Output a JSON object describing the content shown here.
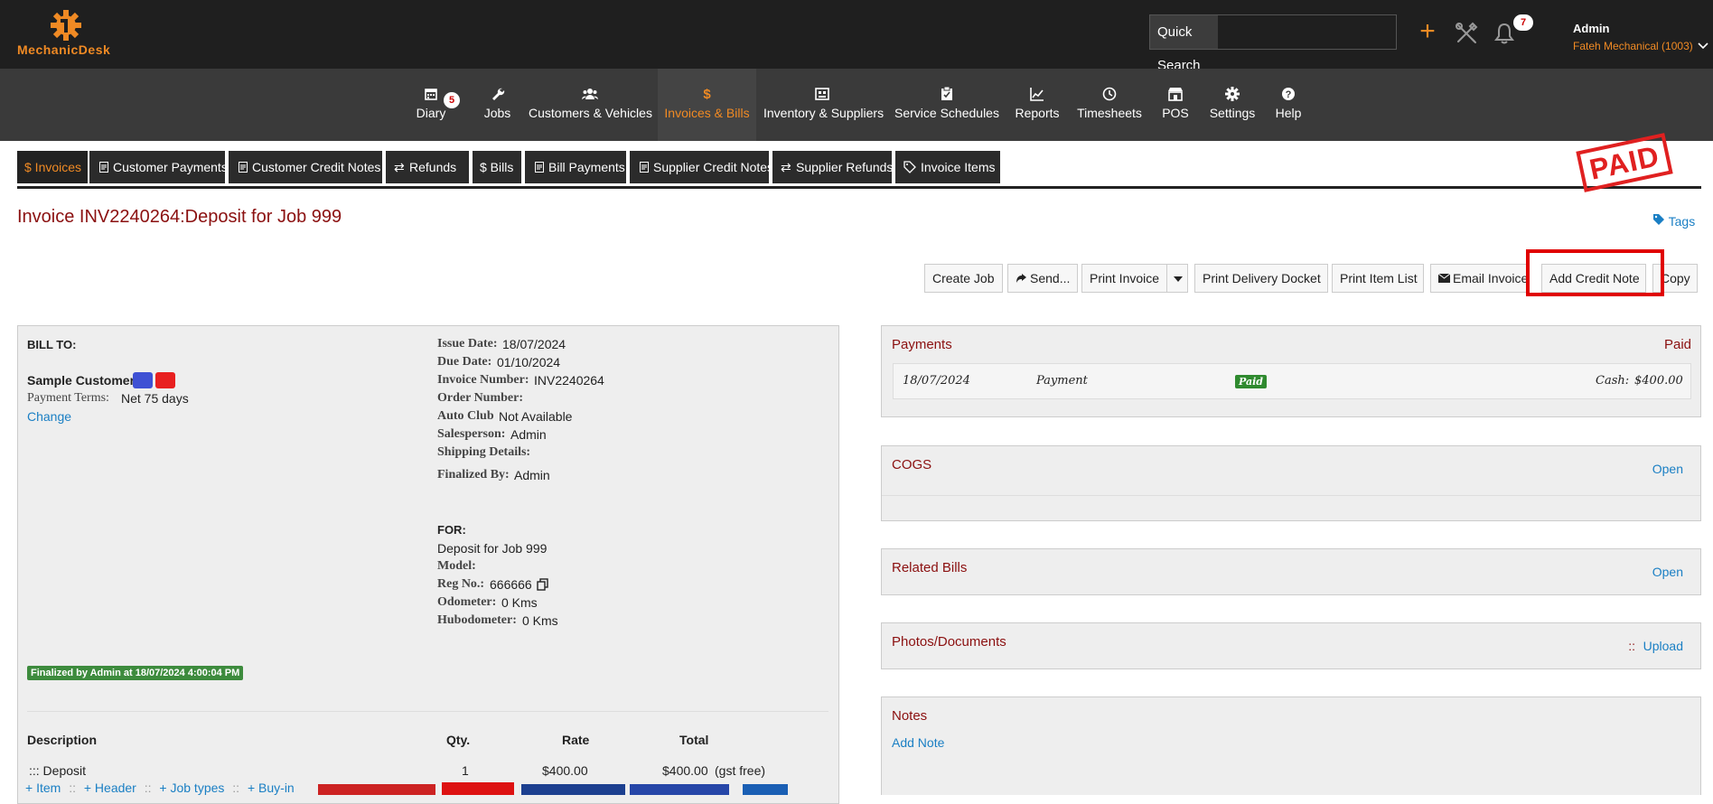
{
  "app": {
    "brand": "MechanicDesk",
    "accent": "#f08a24",
    "title_color": "#8b1010",
    "link_color": "#1a7fc4"
  },
  "topbar": {
    "quick_search_label": "Quick Search",
    "quick_search_value": "",
    "plus_glyph": "+",
    "notifications_count": "7",
    "user": {
      "name": "Admin",
      "org": "Fateh Mechanical (1003)"
    }
  },
  "nav": {
    "items": [
      {
        "label": "Diary",
        "icon": "calendar-icon",
        "badge": "5"
      },
      {
        "label": "Jobs",
        "icon": "wrench-icon"
      },
      {
        "label": "Customers & Vehicles",
        "icon": "users-icon"
      },
      {
        "label": "Invoices & Bills",
        "icon": "dollar-icon",
        "active": true
      },
      {
        "label": "Inventory & Suppliers",
        "icon": "inventory-icon"
      },
      {
        "label": "Service Schedules",
        "icon": "clipboard-icon"
      },
      {
        "label": "Reports",
        "icon": "chart-icon"
      },
      {
        "label": "Timesheets",
        "icon": "clock-icon"
      },
      {
        "label": "POS",
        "icon": "store-icon"
      },
      {
        "label": "Settings",
        "icon": "gear-icon"
      },
      {
        "label": "Help",
        "icon": "help-icon"
      }
    ]
  },
  "subtabs": [
    {
      "label": "$ Invoices",
      "active": true
    },
    {
      "label": "Customer Payments"
    },
    {
      "label": "Customer Credit Notes"
    },
    {
      "label": "Refunds"
    },
    {
      "label": "$ Bills"
    },
    {
      "label": "Bill Payments"
    },
    {
      "label": "Supplier Credit Notes"
    },
    {
      "label": "Supplier Refunds"
    },
    {
      "label": "Invoice Items"
    }
  ],
  "stamp": "PAID",
  "invoice": {
    "title": "Invoice INV2240264:Deposit for Job 999",
    "tags_label": "Tags",
    "actions": {
      "create_job": "Create Job",
      "send": "Send...",
      "print_invoice": "Print Invoice",
      "print_delivery": "Print Delivery Docket",
      "print_item_list": "Print Item List",
      "email_invoice": "Email Invoice",
      "add_credit_note": "Add Credit Note",
      "copy": "Copy"
    },
    "bill_to_label": "BILL TO:",
    "customer_name": "Sample Customer",
    "payment_terms_label": "Payment Terms:",
    "payment_terms": "Net 75 days",
    "change_link": "Change",
    "details": {
      "issue_date_label": "Issue Date:",
      "issue_date": "18/07/2024",
      "due_date_label": "Due Date:",
      "due_date": "01/10/2024",
      "invoice_number_label": "Invoice Number:",
      "invoice_number": "INV2240264",
      "order_number_label": "Order Number:",
      "auto_club_label": "Auto Club",
      "auto_club": "Not Available",
      "salesperson_label": "Salesperson:",
      "salesperson": "Admin",
      "shipping_label": "Shipping Details:",
      "finalized_by_label": "Finalized By:",
      "finalized_by": "Admin"
    },
    "for": {
      "for_label": "FOR:",
      "description": "Deposit for Job 999",
      "model_label": "Model:",
      "reg_label": "Reg No.:",
      "reg": "666666",
      "odometer_label": "Odometer:",
      "odometer": "0 Kms",
      "hubodometer_label": "Hubodometer:",
      "hubodometer": "0 Kms"
    },
    "finalized_badge": "Finalized by Admin at 18/07/2024 4:00:04 PM",
    "table": {
      "headers": {
        "description": "Description",
        "qty": "Qty.",
        "rate": "Rate",
        "total": "Total"
      },
      "rows": [
        {
          "description": "::: Deposit",
          "qty": "1",
          "rate": "$400.00",
          "total": "$400.00",
          "note": "(gst free)"
        }
      ]
    },
    "add_links": {
      "item": "+ Item",
      "header": "+ Header",
      "job_types": "+ Job types",
      "buy_in": "+ Buy-in",
      "sep": "::"
    }
  },
  "payments": {
    "title": "Payments",
    "status": "Paid",
    "rows": [
      {
        "date": "18/07/2024",
        "type": "Payment",
        "badge": "Paid",
        "method": "Cash:",
        "amount": "$400.00"
      }
    ]
  },
  "cogs": {
    "title": "COGS",
    "link": "Open"
  },
  "related_bills": {
    "title": "Related Bills",
    "link": "Open"
  },
  "photos": {
    "title": "Photos/Documents",
    "sep": "::",
    "link": "Upload"
  },
  "notes": {
    "title": "Notes",
    "link": "Add Note"
  }
}
